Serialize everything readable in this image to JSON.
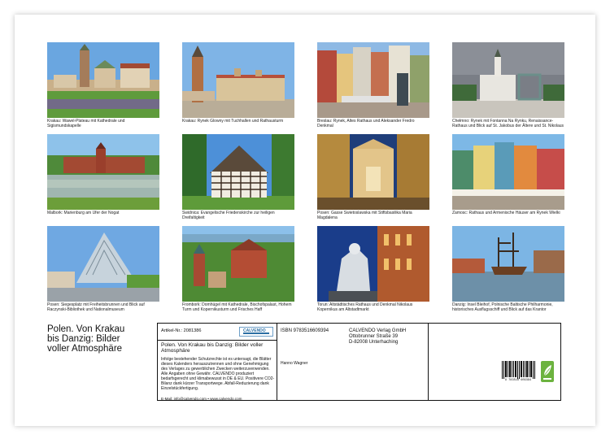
{
  "photos": [
    {
      "caption": "Krakau: Wawel-Plateau mit Kathedrale und Sigismundskapelle",
      "icon": "castle-photo"
    },
    {
      "caption": "Krakau: Rynek Glowny mit Tuchhallen und Rathausturm",
      "icon": "square-photo"
    },
    {
      "caption": "Breslau: Rynek, Altes Rathaus und Aleksander Fredro Denkmal",
      "icon": "market-photo"
    },
    {
      "caption": "Chełmno: Rynek mit Fontanna Na Rynku, Renaissance-Rathaus und Blick auf St. Jakobus der Ältere und St. Nikolaus",
      "icon": "townhall-photo"
    },
    {
      "caption": "Malbork: Marienburg am Ufer der Nogat",
      "icon": "fortress-photo"
    },
    {
      "caption": "Swidnica: Evangelische Friedenskirche zur heiligen Dreifaltigkeit",
      "icon": "church-photo"
    },
    {
      "caption": "Posen: Gasse Swietoslawska mit Stiftsbasilika Maria Magdalena",
      "icon": "night-street-photo"
    },
    {
      "caption": "Zamosc: Rathaus und Armenische Häuser am Rynek Wielki",
      "icon": "colorful-houses-photo"
    },
    {
      "caption": "Posen: Siegesplatz mit Freiheitsbrunnen und Blick auf Raczynski-Bibliothek und Nationalmuseum",
      "icon": "fountain-photo"
    },
    {
      "caption": "Frombork: Domhügel mit Kathedrale, Bischofspalast, Hohem Turm und Kopernikusturm und Frisches Haff",
      "icon": "cathedral-hill-photo"
    },
    {
      "caption": "Torun: Altstädtisches Rathaus und Denkmal Nikolaus Kopernikus am Altstadtmarkt",
      "icon": "statue-photo"
    },
    {
      "caption": "Danzig: Insel Bleihof, Polnische Baltische Philharmonie, historisches Ausflugsschiff und Blick auf das Krantor",
      "icon": "harbor-photo"
    }
  ],
  "cover": {
    "title": "Polen. Von Krakau bis Danzig: Bilder voller Atmosphäre"
  },
  "info": {
    "article_no": "Artikel-Nr.: 2081386",
    "logo_text": "CALVENDO",
    "title": "Polen. Von Krakau bis Danzig: Bilder voller Atmosphäre",
    "legal": "Infolge bestehender Schutzrechte ist es untersagt, die Blätter dieses Kalenders herauszutrennen und ohne Genehmigung des Verlages zu gewerblichen Zwecken weiterzuverwenden. Alle Angaben ohne Gewähr. CALVENDO produziert bedarfsgerecht und klimabewusst in DE & EU. Positivere CO2-Bilanz dank kürzer Transportwege. Abfall-Reduzierung dank Einzelstückfertigung.",
    "contact": "E-Mail: info@calvendo.com • www.calvendo.com",
    "isbn": "ISBN 9783516609394",
    "author": "Hanno Wagner",
    "publisher_line1": "CALVENDO Verlag GmbH",
    "publisher_line2": "Ottobrunner Straße 39",
    "publisher_line3": "D-82008 Unterhaching",
    "barcode_number": "9 783516 609394"
  },
  "colors": {
    "border": "#111111",
    "logo_blue": "#2b6ea3",
    "eco_green": "#6cb33f"
  }
}
